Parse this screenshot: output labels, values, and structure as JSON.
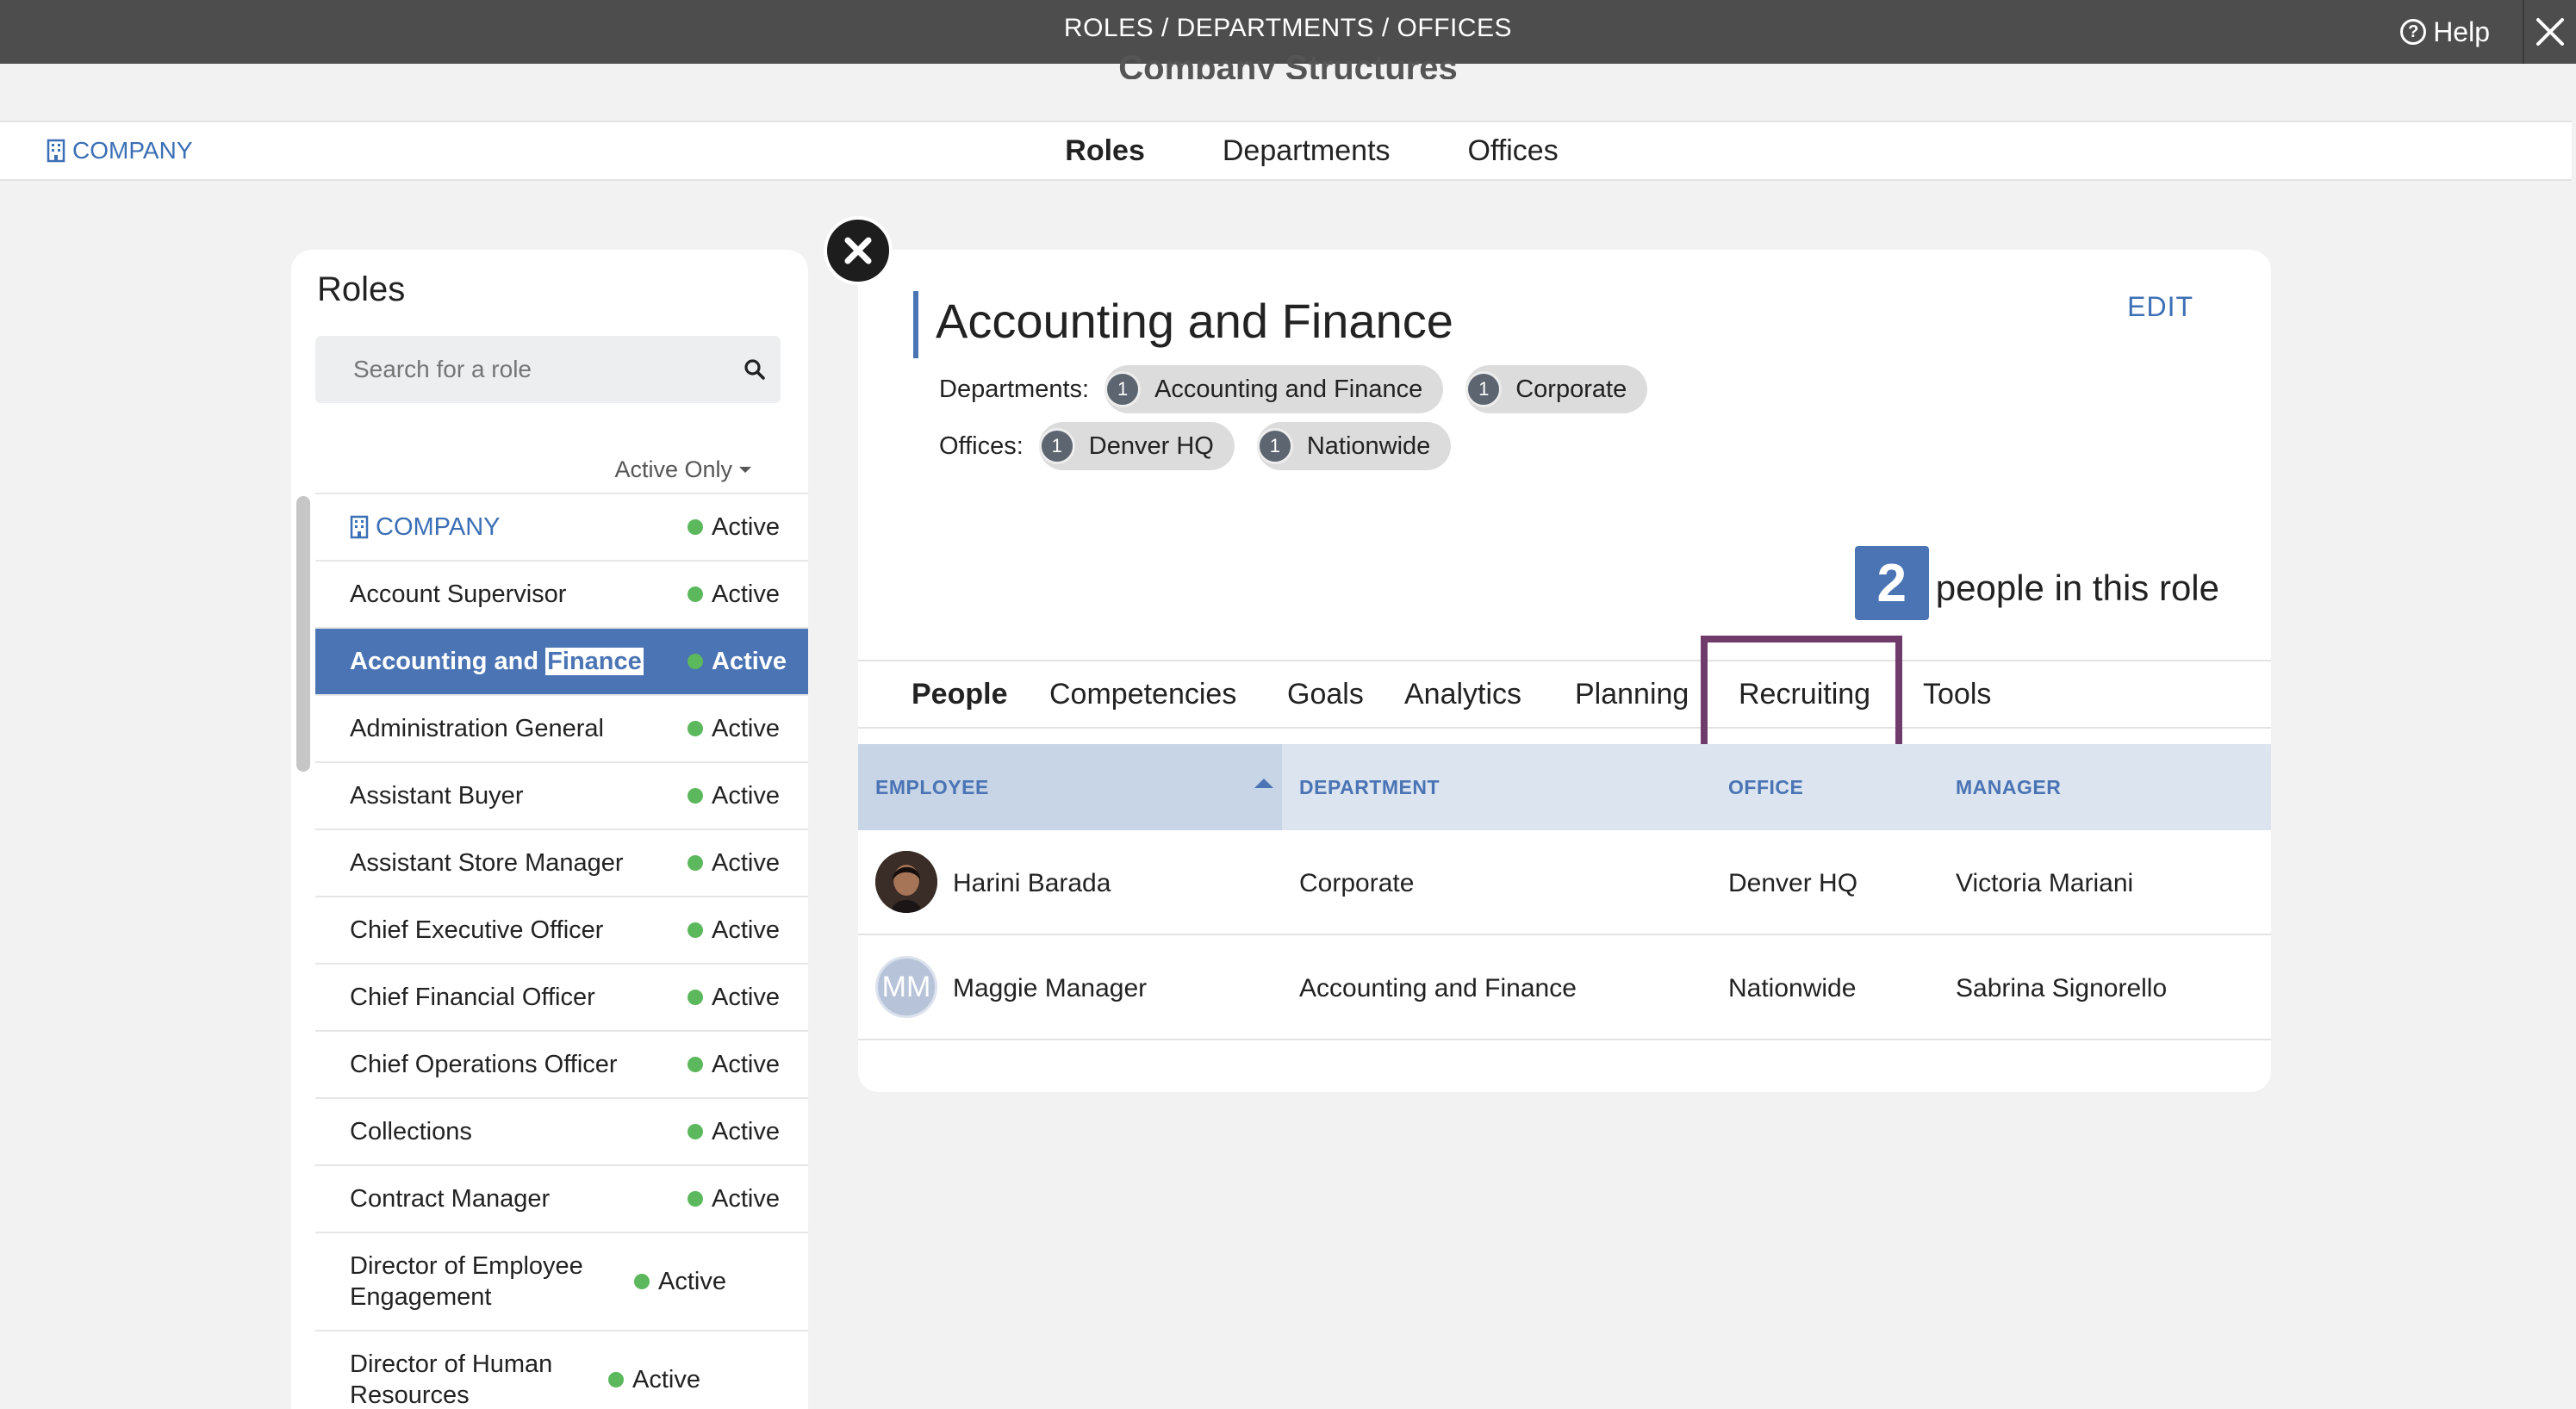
{
  "topbar": {
    "title": "ROLES / DEPARTMENTS / OFFICES",
    "help_label": "Help"
  },
  "page": {
    "heading": "Company Structures"
  },
  "nav": {
    "company_label": "COMPANY",
    "tabs": [
      {
        "label": "Roles",
        "active": true
      },
      {
        "label": "Departments",
        "active": false
      },
      {
        "label": "Offices",
        "active": false
      }
    ]
  },
  "roles_panel": {
    "title": "Roles",
    "search_placeholder": "Search for a role",
    "filter_label": "Active Only",
    "items": [
      {
        "name": "COMPANY",
        "status": "Active"
      },
      {
        "name": "Account Supervisor",
        "status": "Active"
      },
      {
        "name_before": "Accounting and ",
        "name_highlight": "Finance",
        "status": "Active"
      },
      {
        "name": "Administration General",
        "status": "Active"
      },
      {
        "name": "Assistant Buyer",
        "status": "Active"
      },
      {
        "name": "Assistant Store Manager",
        "status": "Active"
      },
      {
        "name": "Chief Executive Officer",
        "status": "Active"
      },
      {
        "name": "Chief Financial Officer",
        "status": "Active"
      },
      {
        "name": "Chief Operations Officer",
        "status": "Active"
      },
      {
        "name": "Collections",
        "status": "Active"
      },
      {
        "name": "Contract Manager",
        "status": "Active"
      },
      {
        "name": "Director of Employee Engagement",
        "status": "Active"
      },
      {
        "name": "Director of Human Resources",
        "status": "Active"
      }
    ]
  },
  "detail": {
    "title": "Accounting and Finance",
    "edit_label": "EDIT",
    "departments_label": "Departments:",
    "departments": [
      {
        "count": "1",
        "name": "Accounting and Finance"
      },
      {
        "count": "1",
        "name": "Corporate"
      }
    ],
    "offices_label": "Offices:",
    "offices": [
      {
        "count": "1",
        "name": "Denver HQ"
      },
      {
        "count": "1",
        "name": "Nationwide"
      }
    ],
    "people_count": "2",
    "people_text": "people in this role",
    "tabs": [
      {
        "label": "People",
        "active": true
      },
      {
        "label": "Competencies",
        "active": false
      },
      {
        "label": "Goals",
        "active": false
      },
      {
        "label": "Analytics",
        "active": false
      },
      {
        "label": "Planning",
        "active": false
      },
      {
        "label": "Recruiting",
        "active": false
      },
      {
        "label": "Tools",
        "active": false
      }
    ],
    "table": {
      "columns": [
        "EMPLOYEE",
        "DEPARTMENT",
        "OFFICE",
        "MANAGER"
      ],
      "rows": [
        {
          "avatar": "photo",
          "employee": "Harini Barada",
          "department": "Corporate",
          "office": "Denver HQ",
          "manager": "Victoria Mariani"
        },
        {
          "avatar": "MM",
          "employee": "Maggie Manager",
          "department": "Accounting and Finance",
          "office": "Nationwide",
          "manager": "Sabrina Signorello"
        }
      ]
    }
  },
  "colors": {
    "accent": "#4a74b4",
    "active_dot": "#5cb85c",
    "highlight_box": "#6e3b6a",
    "topbar": "#4d4d4d"
  }
}
